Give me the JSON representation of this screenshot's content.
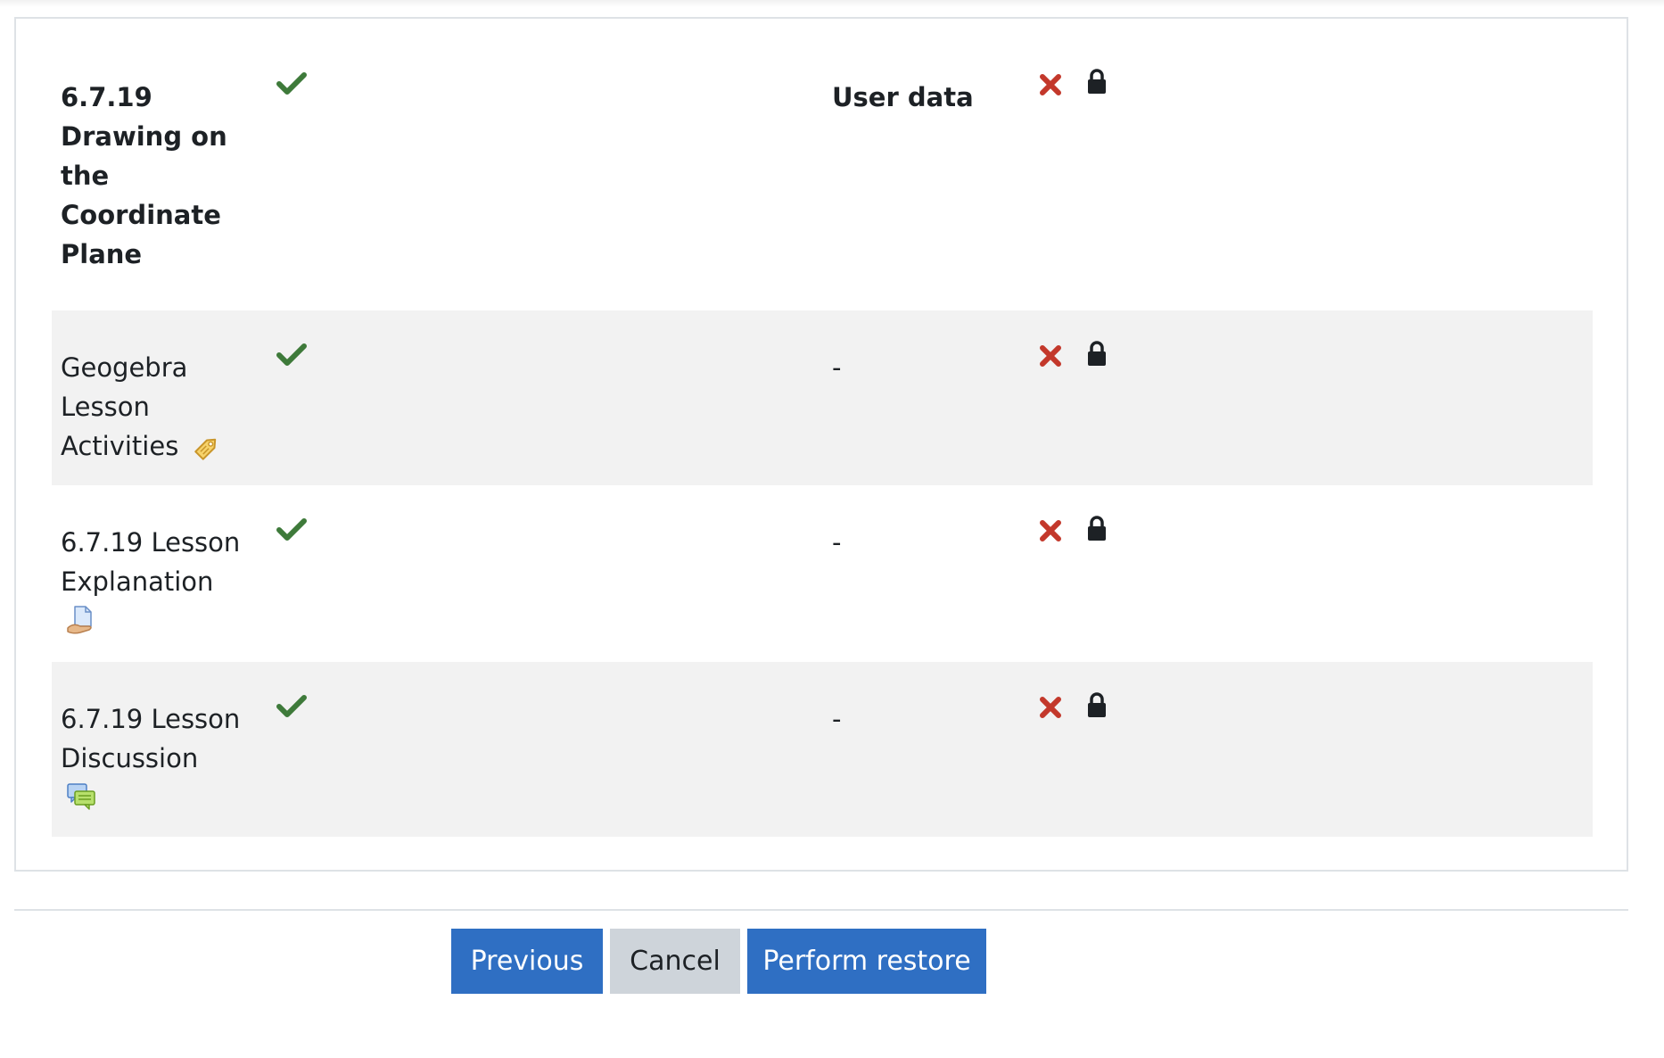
{
  "table": {
    "rows": [
      {
        "name": "6.7.19 Drawing on the Coordinate Plane",
        "included_icon": "check-icon",
        "setting": "User data",
        "userdata_icon": "cross-icon",
        "locked_icon": "lock-icon",
        "activity_icon": ""
      },
      {
        "name": "Geogebra Lesson Activities",
        "included_icon": "check-icon",
        "setting": "-",
        "userdata_icon": "cross-icon",
        "locked_icon": "lock-icon",
        "activity_icon": "label-tag-icon"
      },
      {
        "name": "6.7.19 Lesson Explanation",
        "included_icon": "check-icon",
        "setting": "-",
        "userdata_icon": "cross-icon",
        "locked_icon": "lock-icon",
        "activity_icon": "page-resource-icon"
      },
      {
        "name": "6.7.19 Lesson Discussion",
        "included_icon": "check-icon",
        "setting": "-",
        "userdata_icon": "cross-icon",
        "locked_icon": "lock-icon",
        "activity_icon": "forum-icon"
      }
    ]
  },
  "buttons": {
    "previous_label": "Previous",
    "cancel_label": "Cancel",
    "restore_label": "Perform restore"
  },
  "colors": {
    "check": "#3e7a3a",
    "cross": "#c3382b",
    "lock": "#1d2125",
    "primary": "#2f6fc3",
    "secondary": "#ced4da",
    "row_shade": "#f2f2f2"
  }
}
